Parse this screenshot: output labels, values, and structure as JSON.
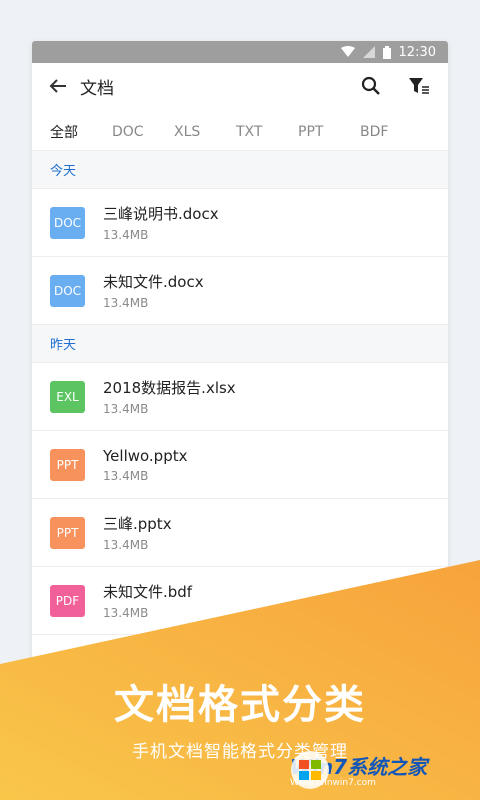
{
  "status": {
    "time": "12:30"
  },
  "toolbar": {
    "title": "文档",
    "back_icon": "arrow-left-icon",
    "search_icon": "search-icon",
    "filter_icon": "filter-icon"
  },
  "tabs": [
    "全部",
    "DOC",
    "XLS",
    "TXT",
    "PPT",
    "BDF"
  ],
  "sections": [
    {
      "label": "今天",
      "files": [
        {
          "badge": "DOC",
          "color": "#6aaef2",
          "name": "三峰说明书.docx",
          "size": "13.4MB"
        },
        {
          "badge": "DOC",
          "color": "#6aaef2",
          "name": "未知文件.docx",
          "size": "13.4MB"
        }
      ]
    },
    {
      "label": "昨天",
      "files": [
        {
          "badge": "EXL",
          "color": "#5cc460",
          "name": "2018数据报告.xlsx",
          "size": "13.4MB"
        },
        {
          "badge": "PPT",
          "color": "#f7925c",
          "name": "Yellwo.pptx",
          "size": "13.4MB"
        },
        {
          "badge": "PPT",
          "color": "#f7925c",
          "name": "三峰.pptx",
          "size": "13.4MB"
        },
        {
          "badge": "PDF",
          "color": "#f2609a",
          "name": "未知文件.bdf",
          "size": "13.4MB"
        }
      ]
    }
  ],
  "promo": {
    "headline": "文档格式分类",
    "subline": "手机文档智能格式分类管理"
  },
  "watermark": {
    "brand": "Win7系统之家",
    "site": "Www.Winwin7.com"
  }
}
